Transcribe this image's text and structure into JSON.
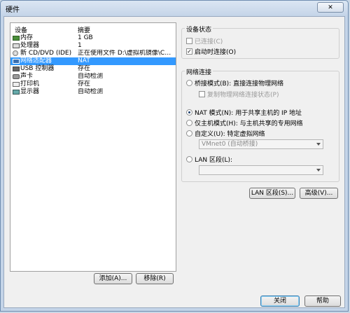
{
  "window": {
    "title": "硬件",
    "close_label": "✕"
  },
  "device_list": {
    "headers": {
      "device": "设备",
      "summary": "摘要"
    },
    "rows": [
      {
        "device": "内存",
        "summary": "1 GB",
        "icon": "memory-icon"
      },
      {
        "device": "处理器",
        "summary": "1",
        "icon": "cpu-icon"
      },
      {
        "device": "新 CD/DVD (IDE)",
        "summary": "正在使用文件 D:\\虚拟机镜像\\Cen...",
        "icon": "cd-icon"
      },
      {
        "device": "网络适配器",
        "summary": "NAT",
        "icon": "network-adapter-icon",
        "selected": true
      },
      {
        "device": "USB 控制器",
        "summary": "存在",
        "icon": "usb-icon"
      },
      {
        "device": "声卡",
        "summary": "自动检测",
        "icon": "sound-card-icon"
      },
      {
        "device": "打印机",
        "summary": "存在",
        "icon": "printer-icon"
      },
      {
        "device": "显示器",
        "summary": "自动检测",
        "icon": "display-icon"
      }
    ],
    "add_label": "添加(A)...",
    "remove_label": "移除(R)"
  },
  "device_status": {
    "title": "设备状态",
    "connected_label": "已连接(C)",
    "connected": false,
    "connect_on_power_label": "启动时连接(O)",
    "connect_on_power": true
  },
  "network": {
    "title": "网络连接",
    "bridged_label": "桥接模式(B): 直接连接物理网络",
    "replicate_label": "复制物理网络连接状态(P)",
    "nat_label": "NAT 模式(N): 用于共享主机的 IP 地址",
    "hostonly_label": "仅主机模式(H): 与主机共享的专用网络",
    "custom_label": "自定义(U): 特定虚拟网络",
    "custom_value": "VMnet0 (自动桥接)",
    "lan_label": "LAN 区段(L):",
    "lan_value": "",
    "selected": "nat"
  },
  "buttons": {
    "lan_segments": "LAN 区段(S)...",
    "advanced": "高级(V)...",
    "close": "关闭",
    "help": "帮助"
  }
}
